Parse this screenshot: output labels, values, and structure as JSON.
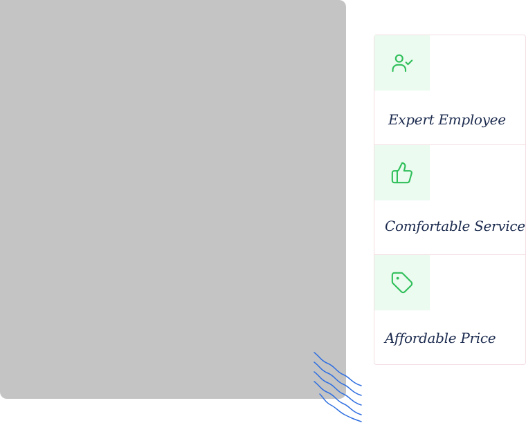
{
  "features": [
    {
      "icon": "user-check-icon",
      "title": "Expert Employee"
    },
    {
      "icon": "thumbs-up-icon",
      "title": "Comfortable Service"
    },
    {
      "icon": "price-tag-icon",
      "title": "Affordable Price"
    }
  ],
  "colors": {
    "placeholder": "#c4c4c4",
    "icon_stroke": "#2fbf5a",
    "icon_bg": "#ebfbef",
    "title_text": "#1b2a4e",
    "card_border": "#f3dde2",
    "wave": "#2f6fe0"
  }
}
